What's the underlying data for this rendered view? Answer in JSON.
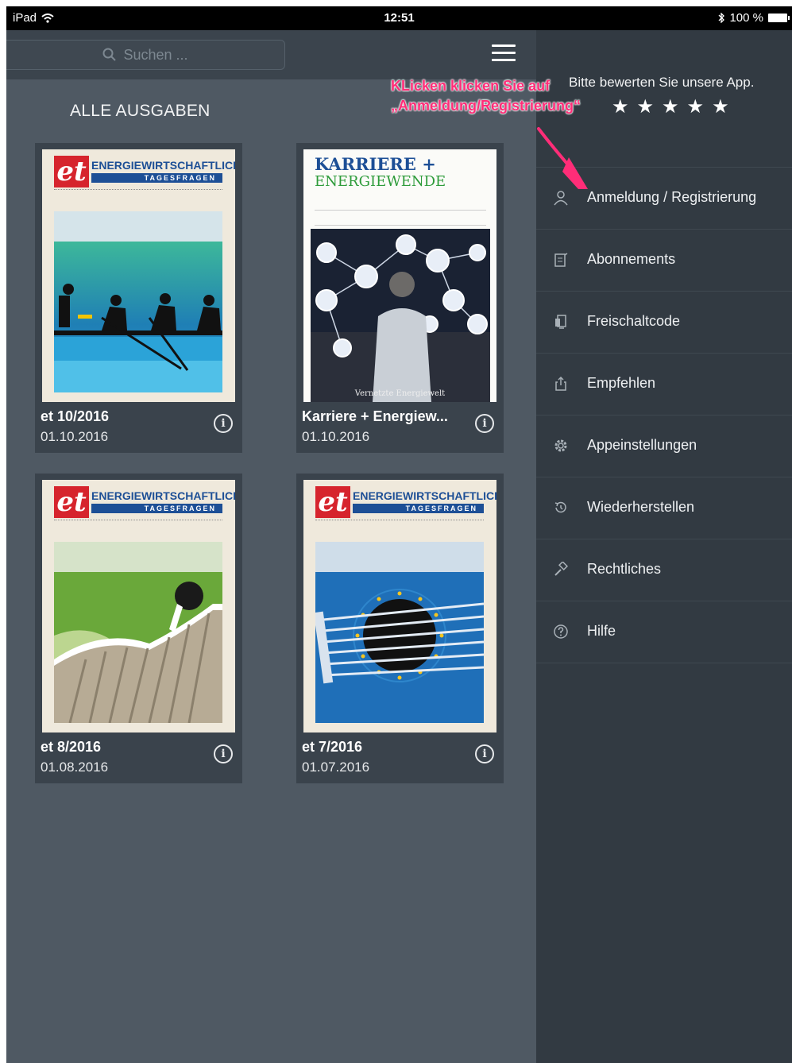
{
  "status_bar": {
    "carrier": "iPad",
    "time": "12:51",
    "battery": "100 %"
  },
  "search": {
    "placeholder": "Suchen ..."
  },
  "section_title": "ALLE AUSGABEN",
  "issues": [
    {
      "title": "et 10/2016",
      "date": "01.10.2016",
      "cover": "ENERGIEWIRTSCHAFTLICHE",
      "cover_bar": "TAGESFRAGEN"
    },
    {
      "title": "Karriere + Energiew...",
      "date": "01.10.2016",
      "cover_line1": "KARRIERE +",
      "cover_line2": "ENERGIEWENDE",
      "cover_footer": "Vernetzte Energiewelt"
    },
    {
      "title": "et 8/2016",
      "date": "01.08.2016",
      "cover": "ENERGIEWIRTSCHAFTLICHE",
      "cover_bar": "TAGESFRAGEN"
    },
    {
      "title": "et 7/2016",
      "date": "01.07.2016",
      "cover": "ENERGIEWIRTSCHAFTLICHE",
      "cover_bar": "TAGESFRAGEN"
    }
  ],
  "info_symbol": "i",
  "drawer": {
    "rate_text": "Bitte bewerten Sie unsere App.",
    "stars": "★★★★★",
    "items": [
      {
        "label": "Anmeldung / Registrierung",
        "icon": "user-icon"
      },
      {
        "label": "Abonnements",
        "icon": "subscription-icon"
      },
      {
        "label": "Freischaltcode",
        "icon": "code-icon"
      },
      {
        "label": "Empfehlen",
        "icon": "share-icon"
      },
      {
        "label": "Appeinstellungen",
        "icon": "gear-icon"
      },
      {
        "label": "Wiederherstellen",
        "icon": "restore-icon"
      },
      {
        "label": "Rechtliches",
        "icon": "gavel-icon"
      },
      {
        "label": "Hilfe",
        "icon": "help-icon"
      }
    ]
  },
  "annotation": {
    "line1": "KLicken klicken Sie auf",
    "line2": "„Anmeldung/Registrierung“"
  },
  "colors": {
    "accent": "#ff2d78",
    "drawer_bg": "#323a42",
    "content_bg": "#4f5963",
    "brand_blue": "#1d4f96",
    "brand_red": "#d6242d"
  }
}
